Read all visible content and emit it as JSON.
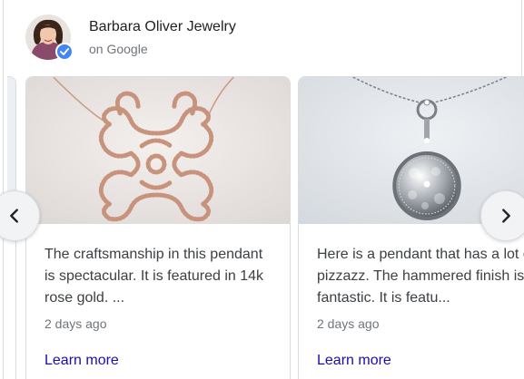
{
  "business": {
    "name": "Barbara Oliver Jewelry",
    "source": "on Google"
  },
  "posts": [
    {
      "description": "The craftsmanship in this pendant is spectacular. It is featured in 14k rose gold. ...",
      "date": "2 days ago",
      "link_label": "Learn more"
    },
    {
      "description": "Here is a pendant that has a lot of pizzazz. The hammered finish is fantastic. It is featu...",
      "date": "2 days ago",
      "link_label": "Learn more"
    }
  ],
  "icons": {
    "previous": "chevron-left-icon",
    "next": "chevron-right-icon",
    "verified": "verified-check-icon"
  },
  "colors": {
    "link": "#1a0dab",
    "verified_badge": "#4285f4"
  }
}
